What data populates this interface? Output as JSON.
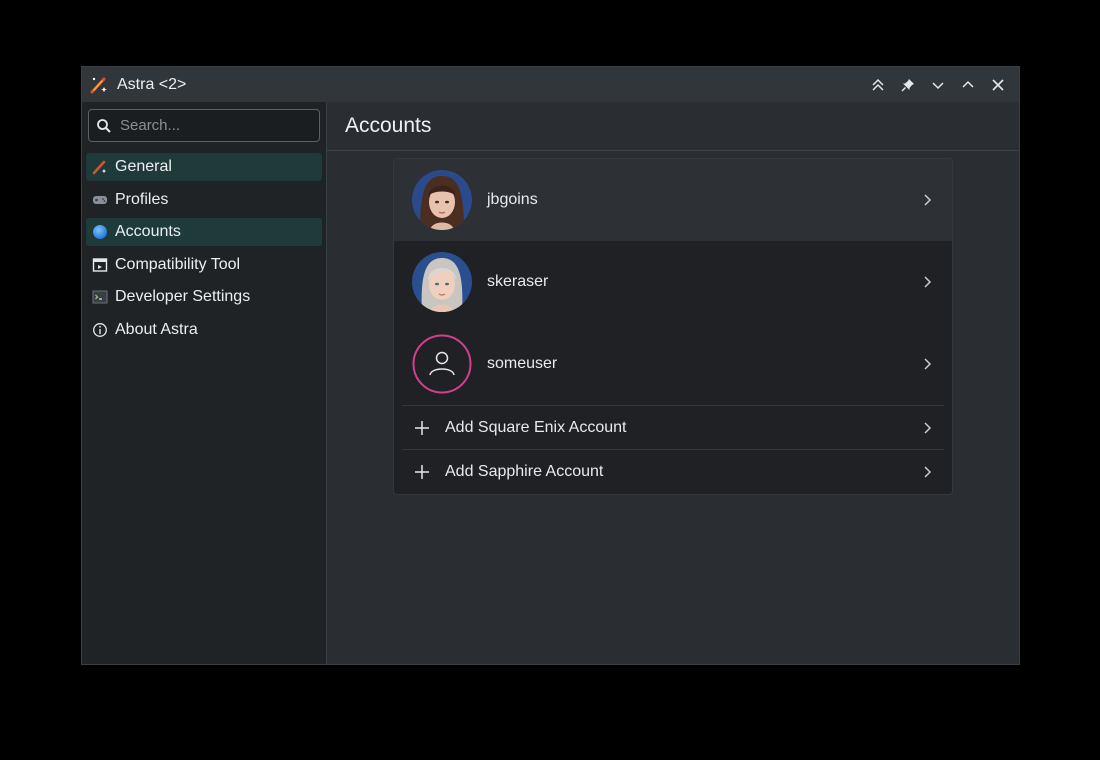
{
  "window": {
    "title": "Astra <2>"
  },
  "titlebar_controls": [
    {
      "name": "keep-above-icon"
    },
    {
      "name": "pin-icon"
    },
    {
      "name": "minimize-icon"
    },
    {
      "name": "maximize-icon"
    },
    {
      "name": "close-icon"
    }
  ],
  "search": {
    "placeholder": "Search..."
  },
  "sidebar": {
    "items": [
      {
        "label": "General",
        "icon": "astra-logo-icon",
        "active": true
      },
      {
        "label": "Profiles",
        "icon": "gamepad-icon",
        "active": false
      },
      {
        "label": "Accounts",
        "icon": "globe-icon",
        "active": true
      },
      {
        "label": "Compatibility Tool",
        "icon": "window-icon",
        "active": false
      },
      {
        "label": "Developer Settings",
        "icon": "terminal-icon",
        "active": false
      },
      {
        "label": "About Astra",
        "icon": "info-icon",
        "active": false
      }
    ]
  },
  "main": {
    "title": "Accounts",
    "accounts": [
      {
        "username": "jbgoins",
        "avatar": "portrait-dark-hair"
      },
      {
        "username": "skeraser",
        "avatar": "portrait-silver-hair"
      },
      {
        "username": "someuser",
        "avatar": "user-placeholder-icon"
      }
    ],
    "actions": [
      {
        "label": "Add Square Enix Account"
      },
      {
        "label": "Add Sapphire Account"
      }
    ]
  },
  "colors": {
    "accent_active": "#1e3b3a",
    "placeholder_ring": "#d43f8d",
    "window_bg": "#2a2e32",
    "sidebar_bg": "#202326"
  }
}
